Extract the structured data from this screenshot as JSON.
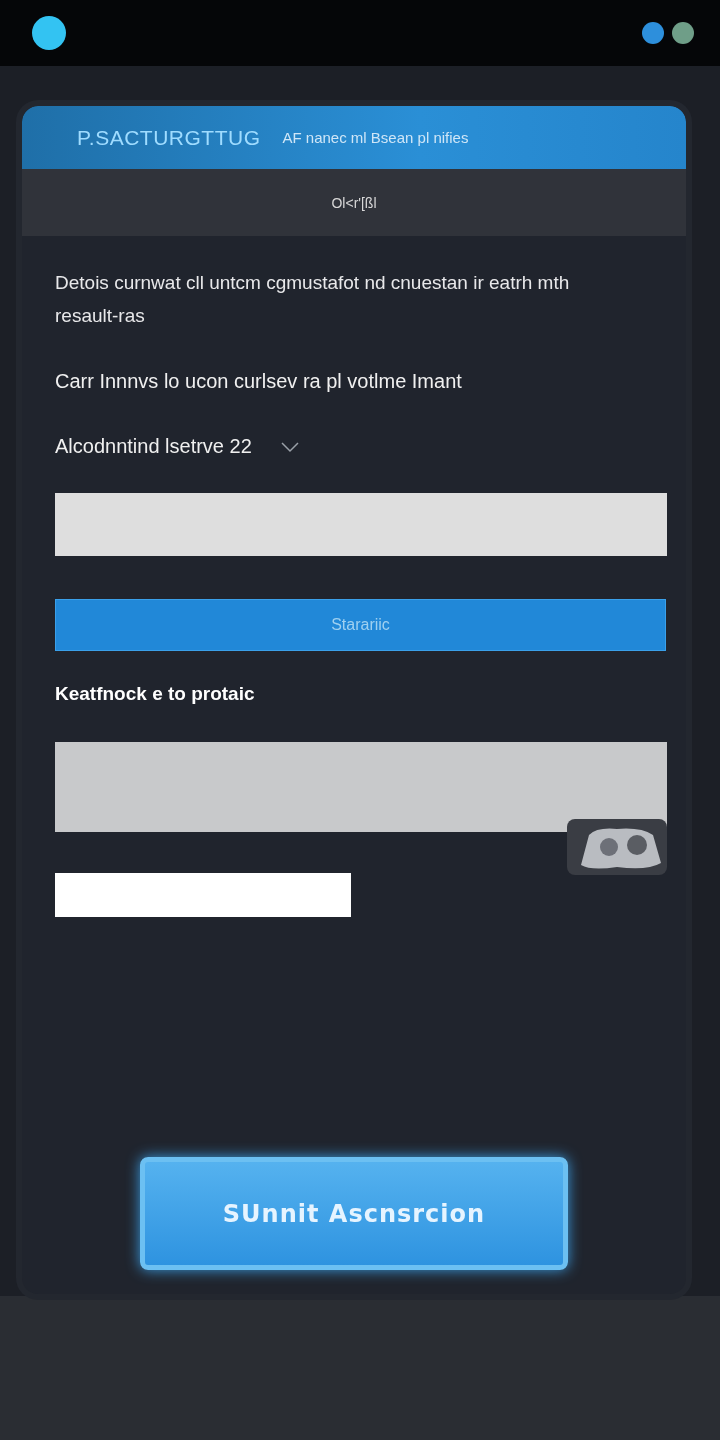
{
  "header": {
    "title": "P.SACTURGTTUG",
    "subtitle": "AF nanec ml Bsean pl nifies"
  },
  "subheader": {
    "label": "Ol<r'[ßl"
  },
  "intro": "Detois curnwat cll untcm cgmustafot nd cnuestan ir eatrh mth resault-ras",
  "note": "Carr Innnvs lo ucon curlsev ra pl votlme Imant",
  "selector": {
    "label": "Alcodnntind lsetrve 22"
  },
  "search_button": {
    "label": "Starariic"
  },
  "section_label": "Keatfnock e to protaic",
  "submit_button": {
    "label": "SUnnit Ascnsrcion"
  }
}
